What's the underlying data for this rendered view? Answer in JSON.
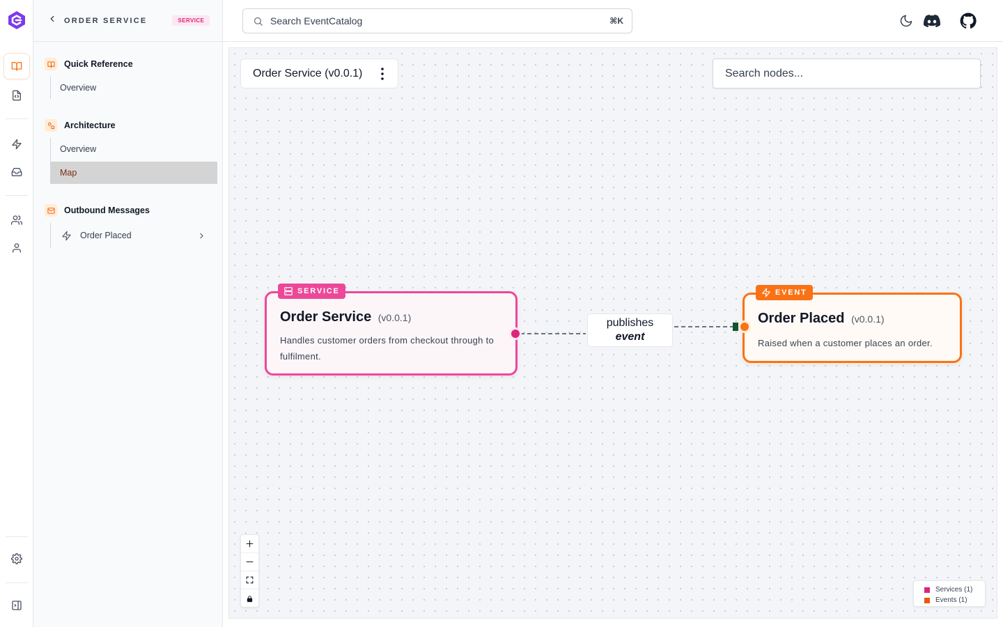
{
  "app": {
    "search_placeholder": "Search EventCatalog",
    "search_shortcut": "⌘K",
    "rail_icons": [
      "eventcatalog-logo-icon",
      "book-icon",
      "file-code-icon",
      "bolt-icon",
      "inbox-icon",
      "users-icon",
      "user-icon",
      "gear-icon",
      "sidebar-toggle-icon"
    ],
    "top_icons": [
      "moon-icon",
      "discord-icon",
      "github-icon"
    ],
    "accent": "#f97316"
  },
  "sidebar": {
    "title": "ORDER SERVICE",
    "badge": "SERVICE",
    "sections": [
      {
        "title": "Quick Reference",
        "icon": "book-open-icon",
        "items": [
          {
            "label": "Overview"
          }
        ]
      },
      {
        "title": "Architecture",
        "icon": "shapes-icon",
        "items": [
          {
            "label": "Overview"
          },
          {
            "label": "Map",
            "active": true
          }
        ]
      },
      {
        "title": "Outbound Messages",
        "icon": "mail-icon",
        "items": [
          {
            "label": "Order Placed",
            "icon": "bolt-icon"
          }
        ]
      }
    ]
  },
  "canvas": {
    "breadcrumb": "Order Service (v0.0.1)",
    "node_search_placeholder": "Search nodes...",
    "nodes": [
      {
        "type_label": "SERVICE",
        "name": "Order Service",
        "version": "(v0.0.1)",
        "description": "Handles customer orders from checkout through to fulfilment.",
        "color": "#ec4899"
      },
      {
        "type_label": "EVENT",
        "name": "Order Placed",
        "version": "(v0.0.1)",
        "description": "Raised when a customer places an order.",
        "color": "#f97316"
      }
    ],
    "edge": {
      "label_line1": "publishes",
      "label_line2": "event"
    },
    "controls": [
      "zoom-in-icon",
      "zoom-out-icon",
      "fit-view-icon",
      "lock-icon"
    ],
    "legend": [
      {
        "label": "Services (1)",
        "color": "#ec4899"
      },
      {
        "label": "Events (1)",
        "color": "#f97316"
      }
    ]
  }
}
